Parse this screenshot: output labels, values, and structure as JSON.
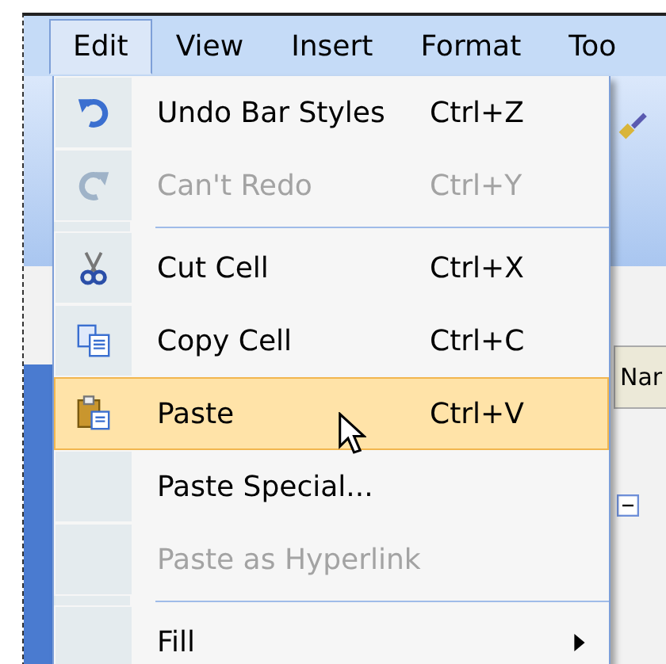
{
  "menu_bar": [
    {
      "label": "Edit",
      "selected": true
    },
    {
      "label": "View",
      "selected": false
    },
    {
      "label": "Insert",
      "selected": false
    },
    {
      "label": "Format",
      "selected": false
    },
    {
      "label": "Too",
      "selected": false
    }
  ],
  "menu": [
    {
      "kind": "item",
      "label": "Undo Bar Styles",
      "shortcut": "Ctrl+Z",
      "disabled": false,
      "selected": false
    },
    {
      "kind": "item",
      "label": "Can't Redo",
      "shortcut": "Ctrl+Y",
      "disabled": true,
      "selected": false
    },
    {
      "kind": "separator"
    },
    {
      "kind": "item",
      "label": "Cut Cell",
      "shortcut": "Ctrl+X",
      "disabled": false,
      "selected": false
    },
    {
      "kind": "item",
      "label": "Copy Cell",
      "shortcut": "Ctrl+C",
      "disabled": false,
      "selected": false
    },
    {
      "kind": "item",
      "label": "Paste",
      "shortcut": "Ctrl+V",
      "disabled": false,
      "selected": true
    },
    {
      "kind": "item",
      "label": "Paste Special...",
      "disabled": false,
      "selected": false
    },
    {
      "kind": "item",
      "label": "Paste as Hyperlink",
      "disabled": true,
      "selected": false
    },
    {
      "kind": "separator"
    },
    {
      "kind": "submenu",
      "label": "Fill",
      "disabled": false,
      "selected": false
    }
  ],
  "background": {
    "column_header": "Nar"
  }
}
